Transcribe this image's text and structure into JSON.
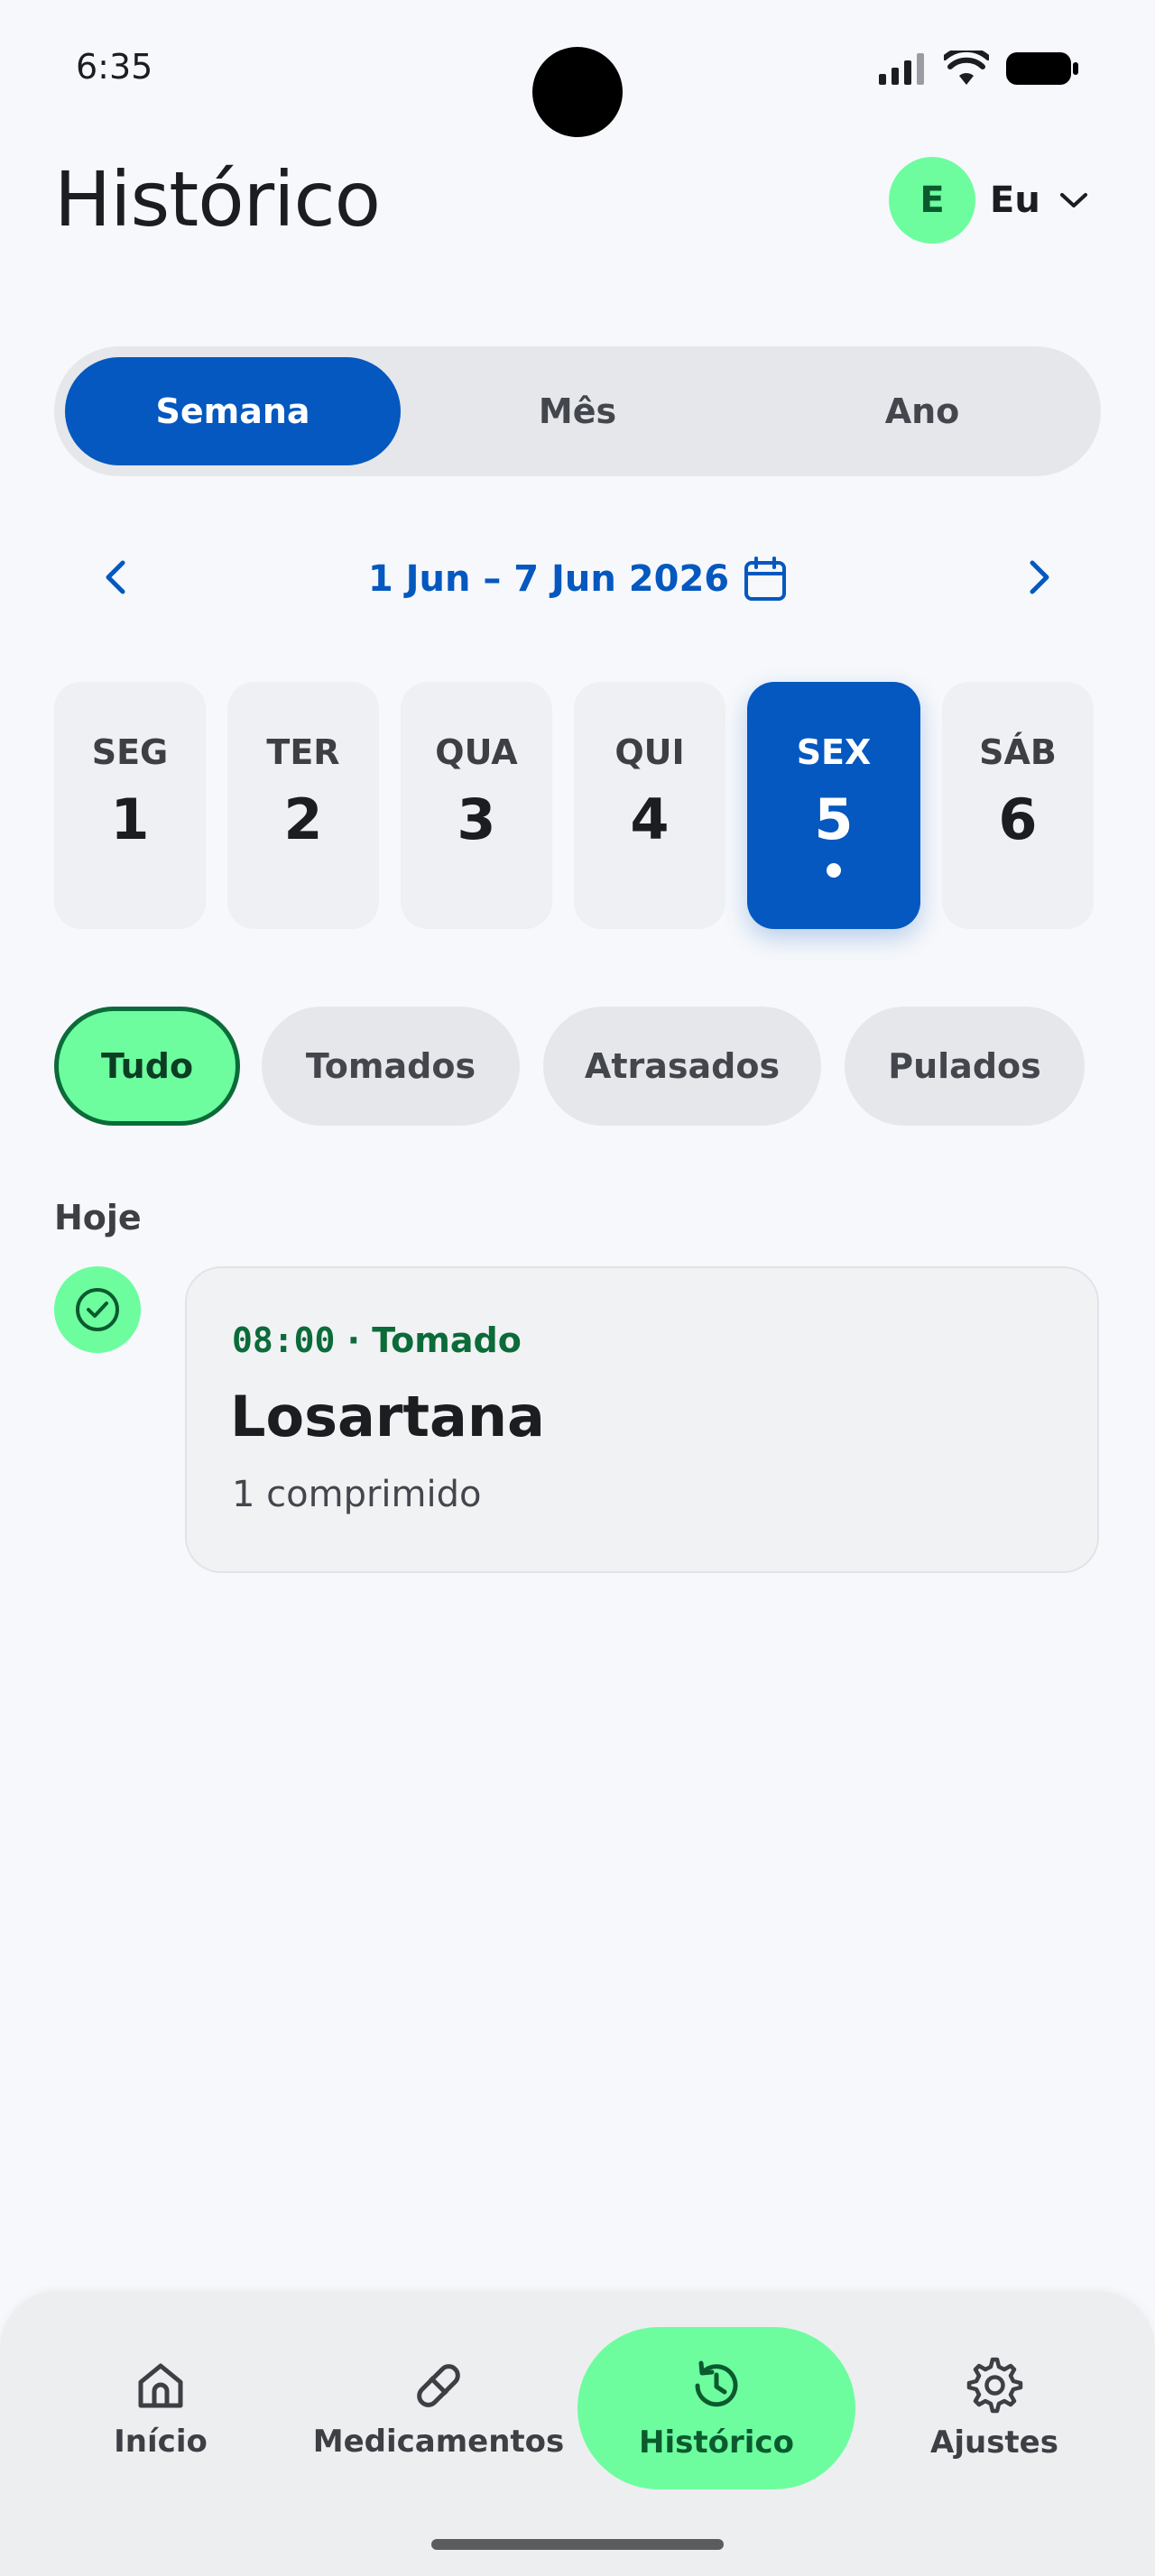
{
  "status_bar": {
    "time": "6:35"
  },
  "header": {
    "title": "Histórico",
    "profile_initial": "E",
    "profile_name": "Eu"
  },
  "segments": [
    {
      "label": "Semana",
      "active": true
    },
    {
      "label": "Mês",
      "active": false
    },
    {
      "label": "Ano",
      "active": false
    }
  ],
  "date_nav": {
    "range": "1 Jun – 7 Jun 2026"
  },
  "days": [
    {
      "dow": "SEG",
      "num": "1"
    },
    {
      "dow": "TER",
      "num": "2"
    },
    {
      "dow": "QUA",
      "num": "3"
    },
    {
      "dow": "QUI",
      "num": "4"
    },
    {
      "dow": "SEX",
      "num": "5",
      "active": true
    },
    {
      "dow": "SÁB",
      "num": "6"
    }
  ],
  "filters": [
    {
      "label": "Tudo",
      "active": true
    },
    {
      "label": "Tomados"
    },
    {
      "label": "Atrasados"
    },
    {
      "label": "Pulados"
    }
  ],
  "section": {
    "label": "Hoje"
  },
  "entry": {
    "time": "08:00",
    "separator": "·",
    "status": "Tomado",
    "name": "Losartana",
    "dose": "1 comprimido"
  },
  "bottom_nav": [
    {
      "label": "Início",
      "icon": "home-icon"
    },
    {
      "label": "Medicamentos",
      "icon": "pill-icon"
    },
    {
      "label": "Histórico",
      "icon": "history-icon",
      "active": true
    },
    {
      "label": "Ajustes",
      "icon": "gear-icon"
    }
  ],
  "colors": {
    "primary": "#0458bf",
    "accent_green": "#6dfd9f",
    "success_text": "#0b6b39",
    "background": "#f6f8fb"
  }
}
